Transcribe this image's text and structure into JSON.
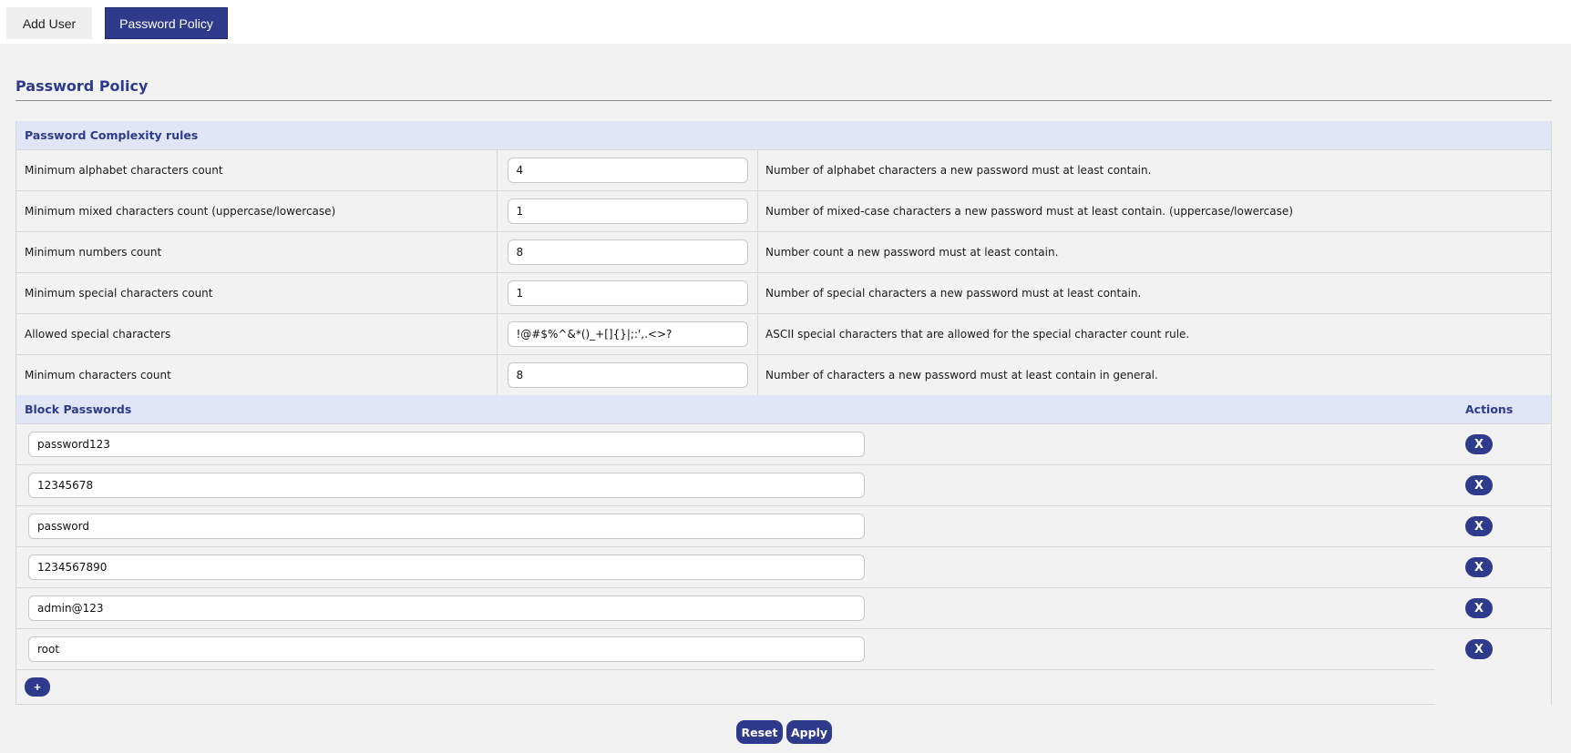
{
  "tabs": [
    {
      "label": "Add User",
      "active": false
    },
    {
      "label": "Password Policy",
      "active": true
    }
  ],
  "page_title": "Password Policy",
  "complexity": {
    "heading": "Password Complexity rules",
    "rules": [
      {
        "label": "Minimum alphabet characters count",
        "value": "4",
        "desc": "Number of alphabet characters a new password must at least contain."
      },
      {
        "label": "Minimum mixed characters count (uppercase/lowercase)",
        "value": "1",
        "desc": "Number of mixed-case characters a new password must at least contain. (uppercase/lowercase)"
      },
      {
        "label": "Minimum numbers count",
        "value": "8",
        "desc": "Number count a new password must at least contain."
      },
      {
        "label": "Minimum special characters count",
        "value": "1",
        "desc": "Number of special characters a new password must at least contain."
      },
      {
        "label": "Allowed special characters",
        "value": "!@#$%^&*()_+[]{}|;:',.<>?",
        "desc": "ASCII special characters that are allowed for the special character count rule."
      },
      {
        "label": "Minimum characters count",
        "value": "8",
        "desc": "Number of characters a new password must at least contain in general."
      }
    ]
  },
  "block": {
    "heading": "Block Passwords",
    "actions_heading": "Actions",
    "delete_label": "X",
    "add_label": "+",
    "passwords": [
      "password123",
      "12345678",
      "password",
      "1234567890",
      "admin@123",
      "root"
    ]
  },
  "footer": {
    "reset_label": "Reset",
    "apply_label": "Apply"
  },
  "colors": {
    "accent": "#2e3a8c",
    "section_bg": "#e0e6f6",
    "page_bg": "#f2f2f2"
  }
}
